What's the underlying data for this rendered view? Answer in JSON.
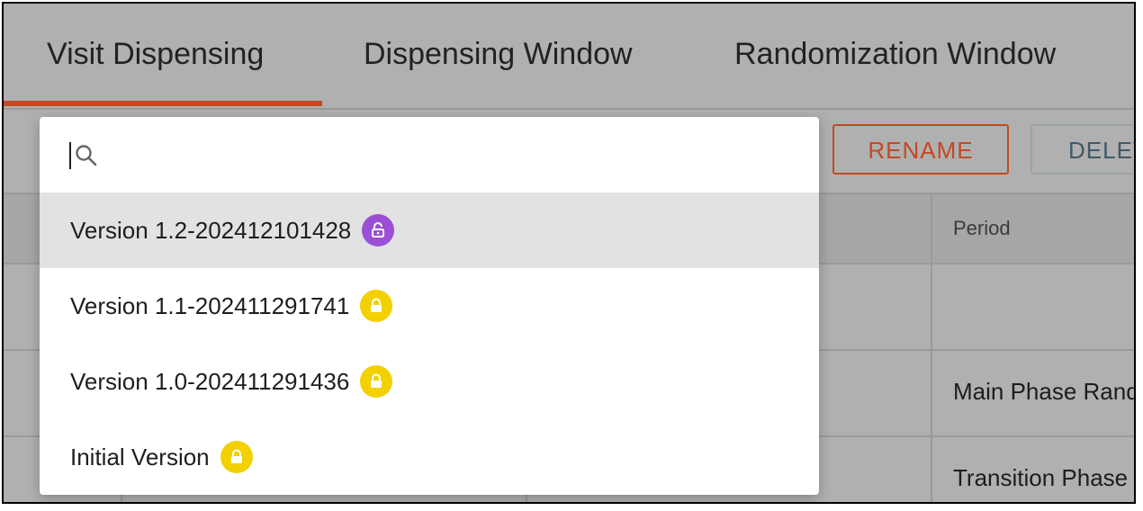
{
  "tabs": [
    {
      "label": "Visit Dispensing",
      "active": true
    },
    {
      "label": "Dispensing Window",
      "active": false
    },
    {
      "label": "Randomization Window",
      "active": false
    }
  ],
  "toolbar": {
    "rename_label": "RENAME",
    "delete_label": "DELETE"
  },
  "table": {
    "header_period": "Period",
    "rows": [
      {
        "period": ""
      },
      {
        "period": "Main Phase Randomization"
      },
      {
        "period": "Transition Phase"
      }
    ]
  },
  "dropdown": {
    "search": {
      "value": "",
      "placeholder": ""
    },
    "options": [
      {
        "label": "Version 1.2-202412101428",
        "lock_state": "unlocked",
        "lock_icon": "unlock-icon",
        "badge_color": "#9b4fd6",
        "selected": true
      },
      {
        "label": "Version 1.1-202411291741",
        "lock_state": "locked",
        "lock_icon": "lock-icon",
        "badge_color": "#f3d000",
        "selected": false
      },
      {
        "label": "Version 1.0-202411291436",
        "lock_state": "locked",
        "lock_icon": "lock-icon",
        "badge_color": "#f3d000",
        "selected": false
      },
      {
        "label": "Initial Version",
        "lock_state": "locked",
        "lock_icon": "lock-icon",
        "badge_color": "#f3d000",
        "selected": false
      }
    ]
  },
  "colors": {
    "accent": "#c24a22",
    "overlay_gray": "#b0b0b0",
    "selected_row": "#e2e2e2"
  }
}
